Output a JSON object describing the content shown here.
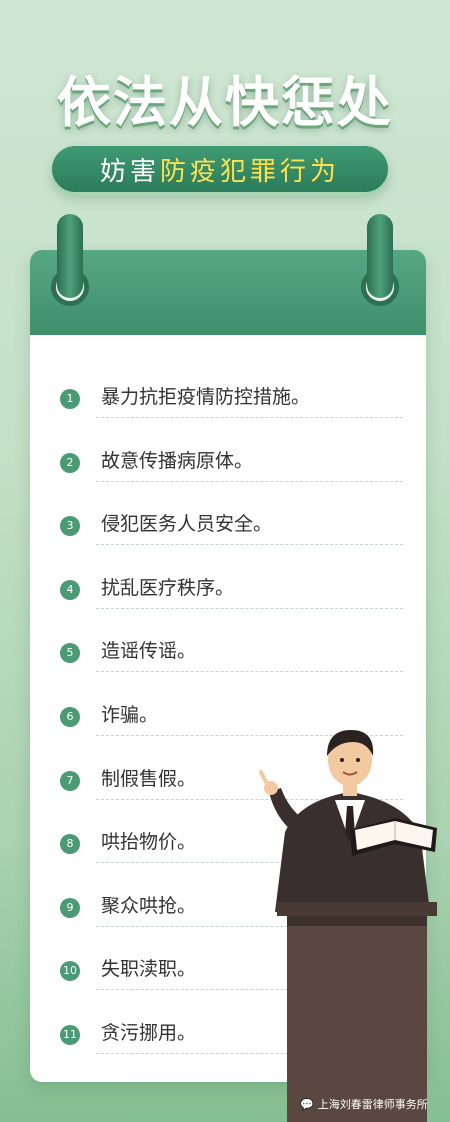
{
  "title": "依法从快惩处",
  "subtitle": {
    "part1": "妨害",
    "part2": "防疫犯罪行为"
  },
  "items": [
    {
      "num": "1",
      "text": "暴力抗拒疫情防控措施。"
    },
    {
      "num": "2",
      "text": "故意传播病原体。"
    },
    {
      "num": "3",
      "text": "侵犯医务人员安全。"
    },
    {
      "num": "4",
      "text": "扰乱医疗秩序。"
    },
    {
      "num": "5",
      "text": "造谣传谣。"
    },
    {
      "num": "6",
      "text": "诈骗。"
    },
    {
      "num": "7",
      "text": "制假售假。"
    },
    {
      "num": "8",
      "text": "哄抬物价。"
    },
    {
      "num": "9",
      "text": "聚众哄抢。"
    },
    {
      "num": "10",
      "text": "失职渎职。"
    },
    {
      "num": "11",
      "text": "贪污挪用。"
    }
  ],
  "watermark": "上海刘春雷律师事务所",
  "colors": {
    "accent": "#3d8e6b",
    "highlight": "#ffe14d"
  }
}
